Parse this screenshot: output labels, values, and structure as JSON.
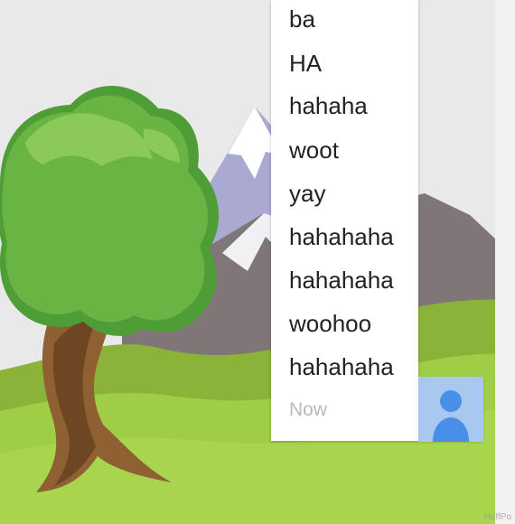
{
  "chat": {
    "messages": [
      "ba",
      "HA",
      "hahaha",
      "woot",
      "yay",
      "hahahaha",
      "hahahaha",
      "woohoo",
      "hahahaha"
    ],
    "timestamp": "Now"
  },
  "watermark": "HuffPo",
  "icons": {
    "avatar": "user-avatar-icon"
  },
  "colors": {
    "panel_bg": "#ffffff",
    "message_text": "#222222",
    "timestamp_text": "#b9b9b9",
    "avatar_bg": "#a9c8ef",
    "avatar_fg": "#4a8fe7",
    "sky": "#e9e9ea",
    "hill_green": "#95c43f",
    "tree_green": "#6bb443"
  }
}
